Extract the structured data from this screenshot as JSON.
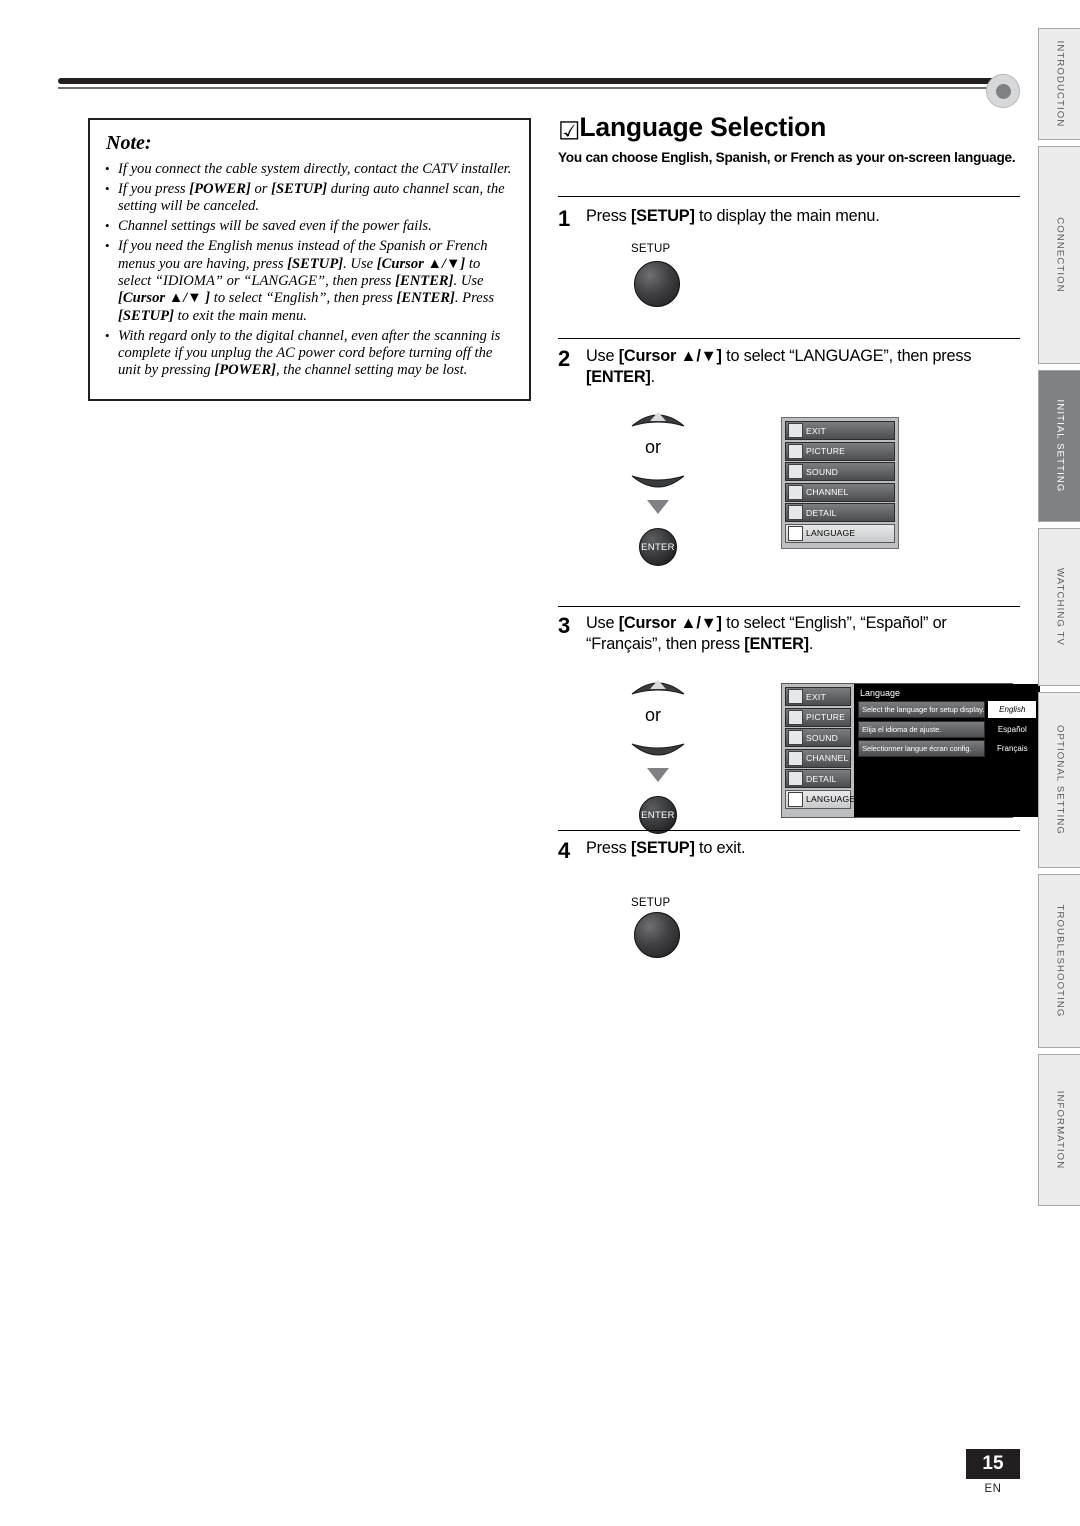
{
  "note": {
    "title": "Note:",
    "items": [
      "If you connect the cable system directly, contact the CATV installer.",
      "If you press [POWER] or [SETUP] during auto channel scan, the setting will be canceled.",
      "Channel settings will be saved even if the power fails.",
      "If you need the English menus instead of the Spanish or French menus you are having, press [SETUP]. Use [Cursor ▲/▼] to select “IDIOMA” or “LANGAGE”, then press [ENTER]. Use [Cursor ▲/▼ ] to select “English”, then press [ENTER]. Press [SETUP] to exit the main menu.",
      "With regard only to the digital channel, even after the scanning is complete if you unplug the AC power cord before turning off the unit by pressing [POWER], the channel setting may be lost."
    ]
  },
  "heading": {
    "check": "☑",
    "title": "Language Selection",
    "subtitle": "You can choose English, Spanish, or French as your on-screen language."
  },
  "steps": [
    {
      "num": "1",
      "text": "Press [SETUP] to display the main menu.",
      "button_label": "SETUP"
    },
    {
      "num": "2",
      "text": "Use [Cursor ▲/▼] to select “LANGUAGE”, then press [ENTER].",
      "or": "or",
      "enter_label": "ENTER"
    },
    {
      "num": "3",
      "text": "Use [Cursor ▲/▼] to select “English”, “Español” or “Français”, then press [ENTER].",
      "or": "or",
      "enter_label": "ENTER"
    },
    {
      "num": "4",
      "text": "Press [SETUP] to exit.",
      "button_label": "SETUP"
    }
  ],
  "menu1": {
    "items": [
      {
        "label": "EXIT",
        "selected": false
      },
      {
        "label": "PICTURE",
        "selected": false
      },
      {
        "label": "SOUND",
        "selected": false
      },
      {
        "label": "CHANNEL",
        "selected": false
      },
      {
        "label": "DETAIL",
        "selected": false
      },
      {
        "label": "LANGUAGE",
        "selected": true
      }
    ]
  },
  "menu2": {
    "left_items": [
      {
        "label": "EXIT",
        "selected": false
      },
      {
        "label": "PICTURE",
        "selected": false
      },
      {
        "label": "SOUND",
        "selected": false
      },
      {
        "label": "CHANNEL",
        "selected": false
      },
      {
        "label": "DETAIL",
        "selected": false
      },
      {
        "label": "LANGUAGE",
        "selected": true
      }
    ],
    "title": "Language",
    "rows": [
      {
        "desc": "Select the language for setup display.",
        "value": "English",
        "selected": true
      },
      {
        "desc": "Elija el idioma de ajuste.",
        "value": "Español",
        "selected": false
      },
      {
        "desc": "Selectionner langue écran config.",
        "value": "Français",
        "selected": false
      }
    ]
  },
  "tabs": [
    {
      "label": "INTRODUCTION",
      "active": false
    },
    {
      "label": "CONNECTION",
      "active": false
    },
    {
      "label": "INITIAL SETTING",
      "active": true
    },
    {
      "label": "WATCHING TV",
      "active": false
    },
    {
      "label": "OPTIONAL SETTING",
      "active": false
    },
    {
      "label": "TROUBLESHOOTING",
      "active": false
    },
    {
      "label": "INFORMATION",
      "active": false
    }
  ],
  "footer": {
    "page": "15",
    "lang": "EN"
  }
}
